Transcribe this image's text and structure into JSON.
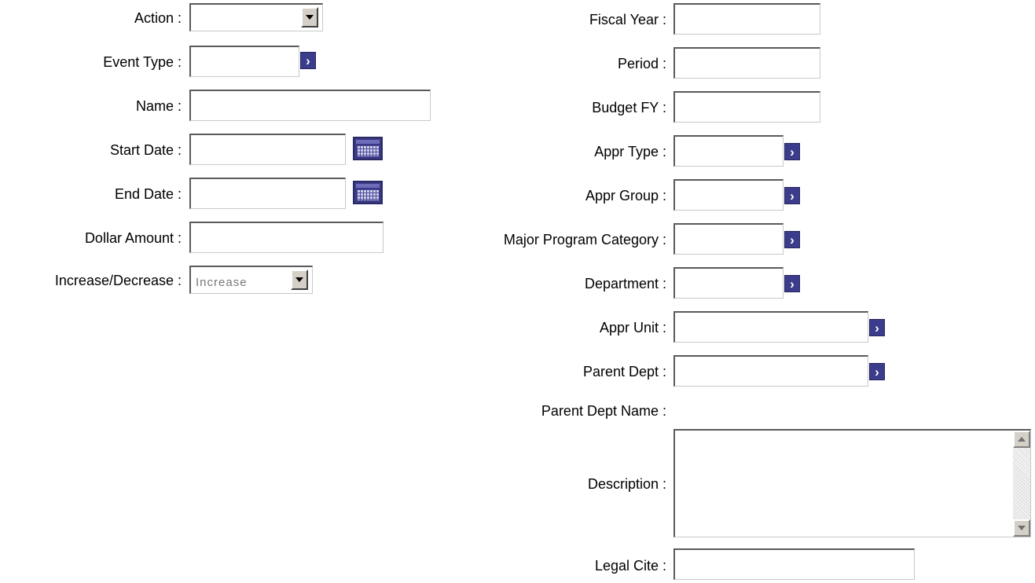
{
  "left": {
    "action": {
      "label": "Action :",
      "value": ""
    },
    "event_type": {
      "label": "Event Type :",
      "value": ""
    },
    "name": {
      "label": "Name :",
      "value": ""
    },
    "start_date": {
      "label": "Start Date :",
      "value": ""
    },
    "end_date": {
      "label": "End Date :",
      "value": ""
    },
    "dollar_amount": {
      "label": "Dollar Amount :",
      "value": ""
    },
    "increase_decrease": {
      "label": "Increase/Decrease :",
      "value": "Increase"
    }
  },
  "right": {
    "fiscal_year": {
      "label": "Fiscal Year :",
      "value": ""
    },
    "period": {
      "label": "Period :",
      "value": ""
    },
    "budget_fy": {
      "label": "Budget FY :",
      "value": ""
    },
    "appr_type": {
      "label": "Appr Type :",
      "value": ""
    },
    "appr_group": {
      "label": "Appr Group :",
      "value": ""
    },
    "major_program_category": {
      "label": "Major Program Category :",
      "value": ""
    },
    "department": {
      "label": "Department :",
      "value": ""
    },
    "appr_unit": {
      "label": "Appr Unit :",
      "value": ""
    },
    "parent_dept": {
      "label": "Parent Dept :",
      "value": ""
    },
    "parent_dept_name": {
      "label": "Parent Dept Name :",
      "value": ""
    },
    "description": {
      "label": "Description :",
      "value": ""
    },
    "legal_cite": {
      "label": "Legal Cite :",
      "value": ""
    }
  },
  "icons": {
    "lookup_glyph": "›",
    "lookup_color": "#3c3c8c",
    "calendar_color": "#3a3a86"
  }
}
